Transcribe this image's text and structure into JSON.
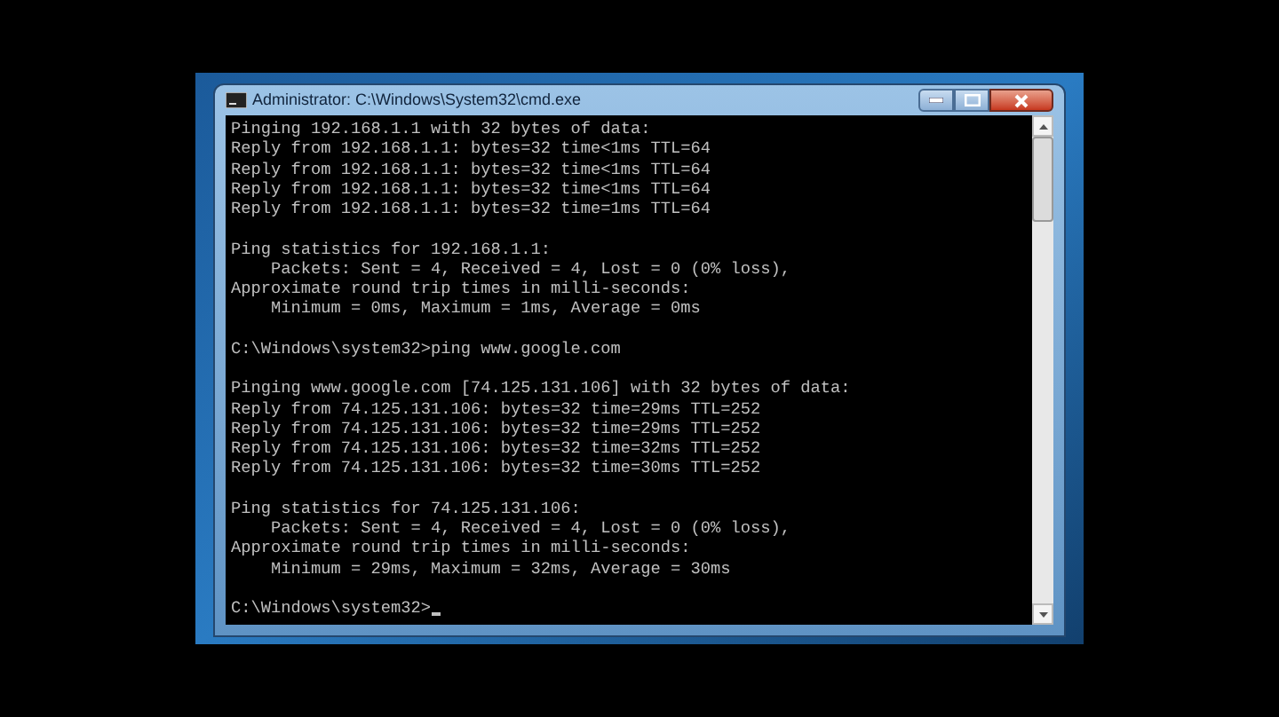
{
  "window": {
    "title": "Administrator: C:\\Windows\\System32\\cmd.exe"
  },
  "console": {
    "blocks": [
      [
        "Pinging 192.168.1.1 with 32 bytes of data:",
        "Reply from 192.168.1.1: bytes=32 time<1ms TTL=64",
        "Reply from 192.168.1.1: bytes=32 time<1ms TTL=64",
        "Reply from 192.168.1.1: bytes=32 time<1ms TTL=64",
        "Reply from 192.168.1.1: bytes=32 time=1ms TTL=64"
      ],
      [
        "Ping statistics for 192.168.1.1:",
        "    Packets: Sent = 4, Received = 4, Lost = 0 (0% loss),",
        "Approximate round trip times in milli-seconds:",
        "    Minimum = 0ms, Maximum = 1ms, Average = 0ms"
      ],
      [
        "C:\\Windows\\system32>ping www.google.com"
      ],
      [
        "Pinging www.google.com [74.125.131.106] with 32 bytes of data:",
        "Reply from 74.125.131.106: bytes=32 time=29ms TTL=252",
        "Reply from 74.125.131.106: bytes=32 time=29ms TTL=252",
        "Reply from 74.125.131.106: bytes=32 time=32ms TTL=252",
        "Reply from 74.125.131.106: bytes=32 time=30ms TTL=252"
      ],
      [
        "Ping statistics for 74.125.131.106:",
        "    Packets: Sent = 4, Received = 4, Lost = 0 (0% loss),",
        "Approximate round trip times in milli-seconds:",
        "    Minimum = 29ms, Maximum = 32ms, Average = 30ms"
      ]
    ],
    "prompt": "C:\\Windows\\system32>",
    "cursor": true
  }
}
